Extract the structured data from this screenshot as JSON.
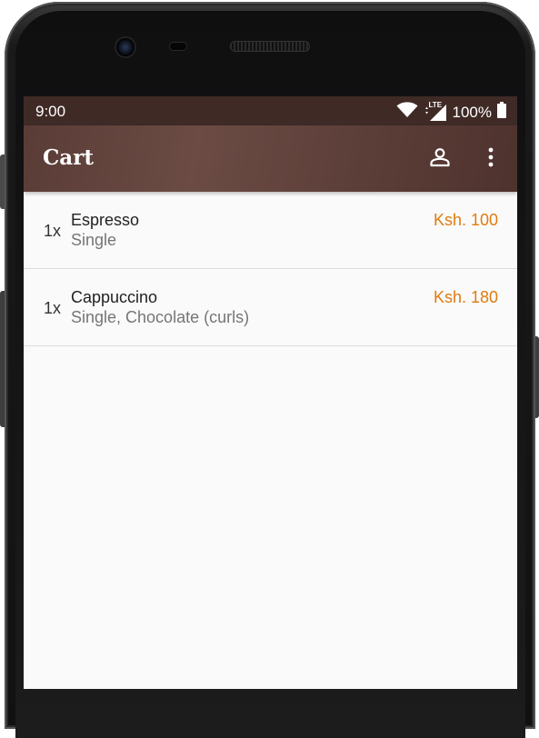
{
  "status_bar": {
    "time": "9:00",
    "battery": "100%",
    "network_label": "LTE",
    "icons": [
      "wifi-icon",
      "lte-signal-icon",
      "battery-icon"
    ]
  },
  "app_bar": {
    "title": "Cart",
    "actions": [
      "account-icon",
      "more-vert-icon"
    ]
  },
  "cart": {
    "items": [
      {
        "quantity": "1x",
        "name": "Espresso",
        "options": "Single",
        "price": "Ksh. 100"
      },
      {
        "quantity": "1x",
        "name": "Cappuccino",
        "options": "Single, Chocolate (curls)",
        "price": "Ksh. 180"
      }
    ]
  },
  "colors": {
    "status_bar": "#3f2a26",
    "app_bar": "#5a3c36",
    "price_accent": "#e07b10",
    "background": "#fafafa"
  }
}
